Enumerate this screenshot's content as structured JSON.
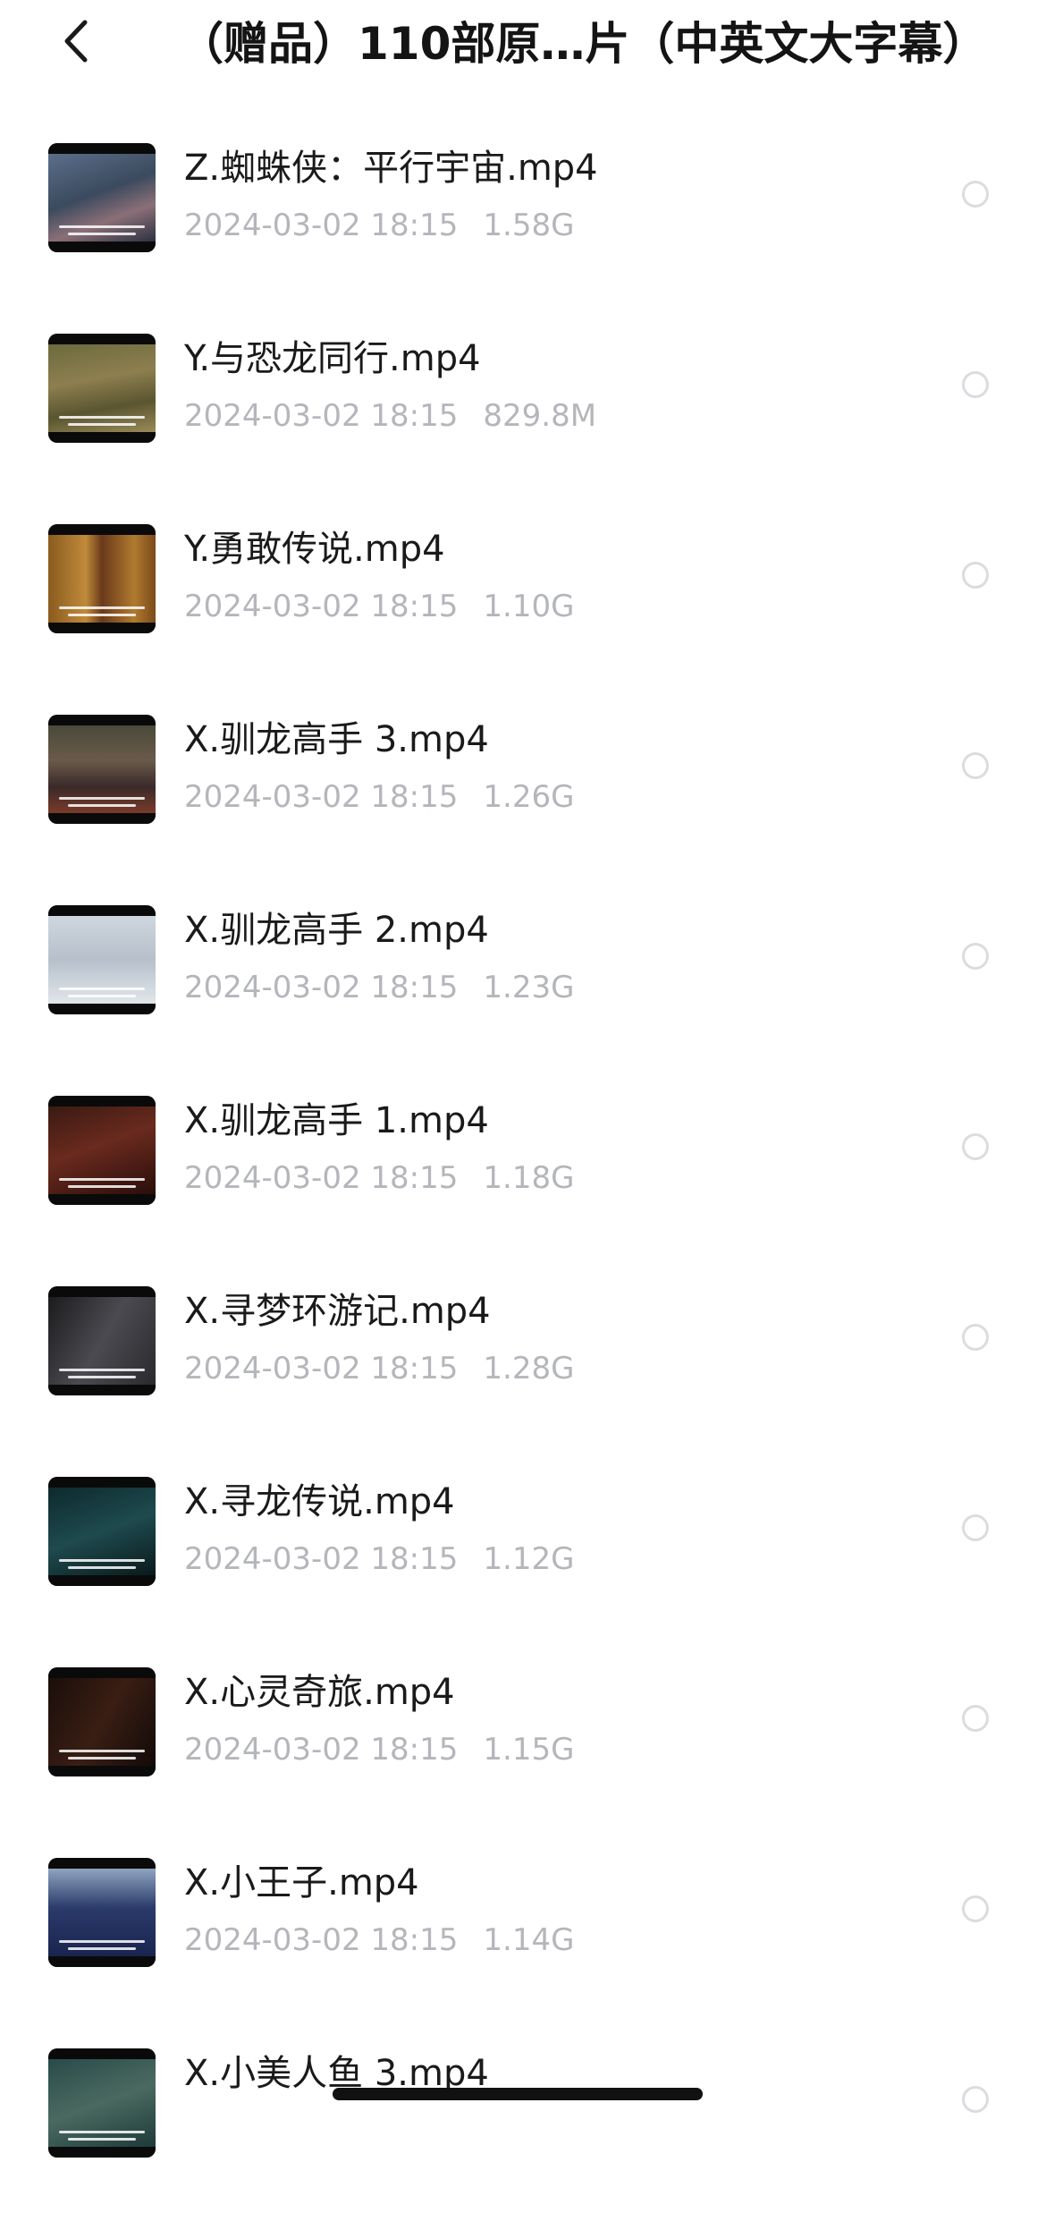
{
  "header": {
    "title": "（赠品）110部原…片（中英文大字幕）"
  },
  "icons": {
    "back": "chevron-left-icon",
    "select": "radio-circle-icon"
  },
  "colors": {
    "meta_text": "#b4b6bb",
    "radio_border": "#dadcdf"
  },
  "files": [
    {
      "name": "Z.蜘蛛侠：平行宇宙.mp4",
      "date": "2024-03-02 18:15",
      "size": "1.58G",
      "thumb": "city-scene"
    },
    {
      "name": "Y.与恐龙同行.mp4",
      "date": "2024-03-02 18:15",
      "size": "829.8M",
      "thumb": "grass-scene"
    },
    {
      "name": "Y.勇敢传说.mp4",
      "date": "2024-03-02 18:15",
      "size": "1.10G",
      "thumb": "warm-interior"
    },
    {
      "name": "X.驯龙高手 3.mp4",
      "date": "2024-03-02 18:15",
      "size": "1.26G",
      "thumb": "crowd-scene"
    },
    {
      "name": "X.驯龙高手 2.mp4",
      "date": "2024-03-02 18:15",
      "size": "1.23G",
      "thumb": "sky-flight"
    },
    {
      "name": "X.驯龙高手 1.mp4",
      "date": "2024-03-02 18:15",
      "size": "1.18G",
      "thumb": "dark-character"
    },
    {
      "name": "X.寻梦环游记.mp4",
      "date": "2024-03-02 18:15",
      "size": "1.28G",
      "thumb": "dark-room"
    },
    {
      "name": "X.寻龙传说.mp4",
      "date": "2024-03-02 18:15",
      "size": "1.12G",
      "thumb": "teal-cave"
    },
    {
      "name": "X.心灵奇旅.mp4",
      "date": "2024-03-02 18:15",
      "size": "1.15G",
      "thumb": "dark-portrait"
    },
    {
      "name": "X.小王子.mp4",
      "date": "2024-03-02 18:15",
      "size": "1.14G",
      "thumb": "blue-car"
    },
    {
      "name": "X.小美人鱼 3.mp4",
      "date": "",
      "size": "",
      "thumb": "seaweed"
    }
  ]
}
